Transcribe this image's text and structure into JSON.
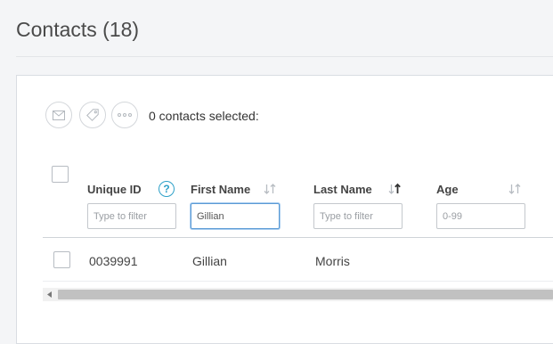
{
  "page": {
    "title": "Contacts (18)"
  },
  "toolbar": {
    "buttons": [
      {
        "icon": "envelope-icon"
      },
      {
        "icon": "tag-icon"
      },
      {
        "icon": "more-dots-icon"
      }
    ],
    "selected_text": "0 contacts selected:"
  },
  "table": {
    "columns": [
      {
        "label": "Unique ID",
        "help": "?",
        "filter_placeholder": "Type to filter",
        "filter_value": ""
      },
      {
        "label": "First Name",
        "sort": "none",
        "filter_placeholder": "",
        "filter_value": "Gillian"
      },
      {
        "label": "Last Name",
        "sort": "ascending",
        "filter_placeholder": "Type to filter",
        "filter_value": ""
      },
      {
        "label": "Age",
        "sort": "none",
        "filter_placeholder": "0-99",
        "filter_value": ""
      }
    ],
    "rows": [
      {
        "unique_id": "0039991",
        "first_name": "Gillian",
        "last_name": "Morris"
      }
    ]
  },
  "colors": {
    "accent": "#2ea0c8",
    "focus": "#5b9ad5"
  }
}
